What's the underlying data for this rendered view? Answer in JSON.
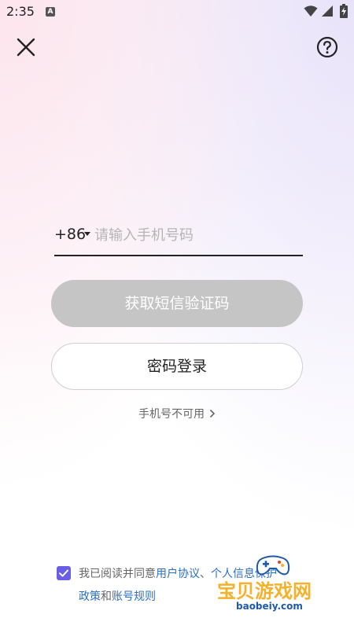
{
  "status_bar": {
    "time": "2:35",
    "notification_icon": "A"
  },
  "header": {
    "close_icon": "close-icon",
    "help_icon": "help-icon"
  },
  "phone": {
    "country_code": "+86",
    "placeholder": "请输入手机号码",
    "value": ""
  },
  "buttons": {
    "get_code": "获取短信验证码",
    "password_login": "密码登录"
  },
  "phone_unavailable": "手机号不可用",
  "agreement": {
    "checked": true,
    "prefix": "我已阅读并同意",
    "user_agreement": "用户协议",
    "sep": "、",
    "privacy_part1": "个人信息保护",
    "privacy_part2": "政策",
    "and": "和",
    "account_rules": "账号规则"
  },
  "watermark": {
    "text": "宝贝游戏网",
    "url": "baobeiy.com"
  },
  "colors": {
    "accent": "#6a5de6",
    "link": "#2d6fc0",
    "disabled_button": "#c5c5c5"
  }
}
